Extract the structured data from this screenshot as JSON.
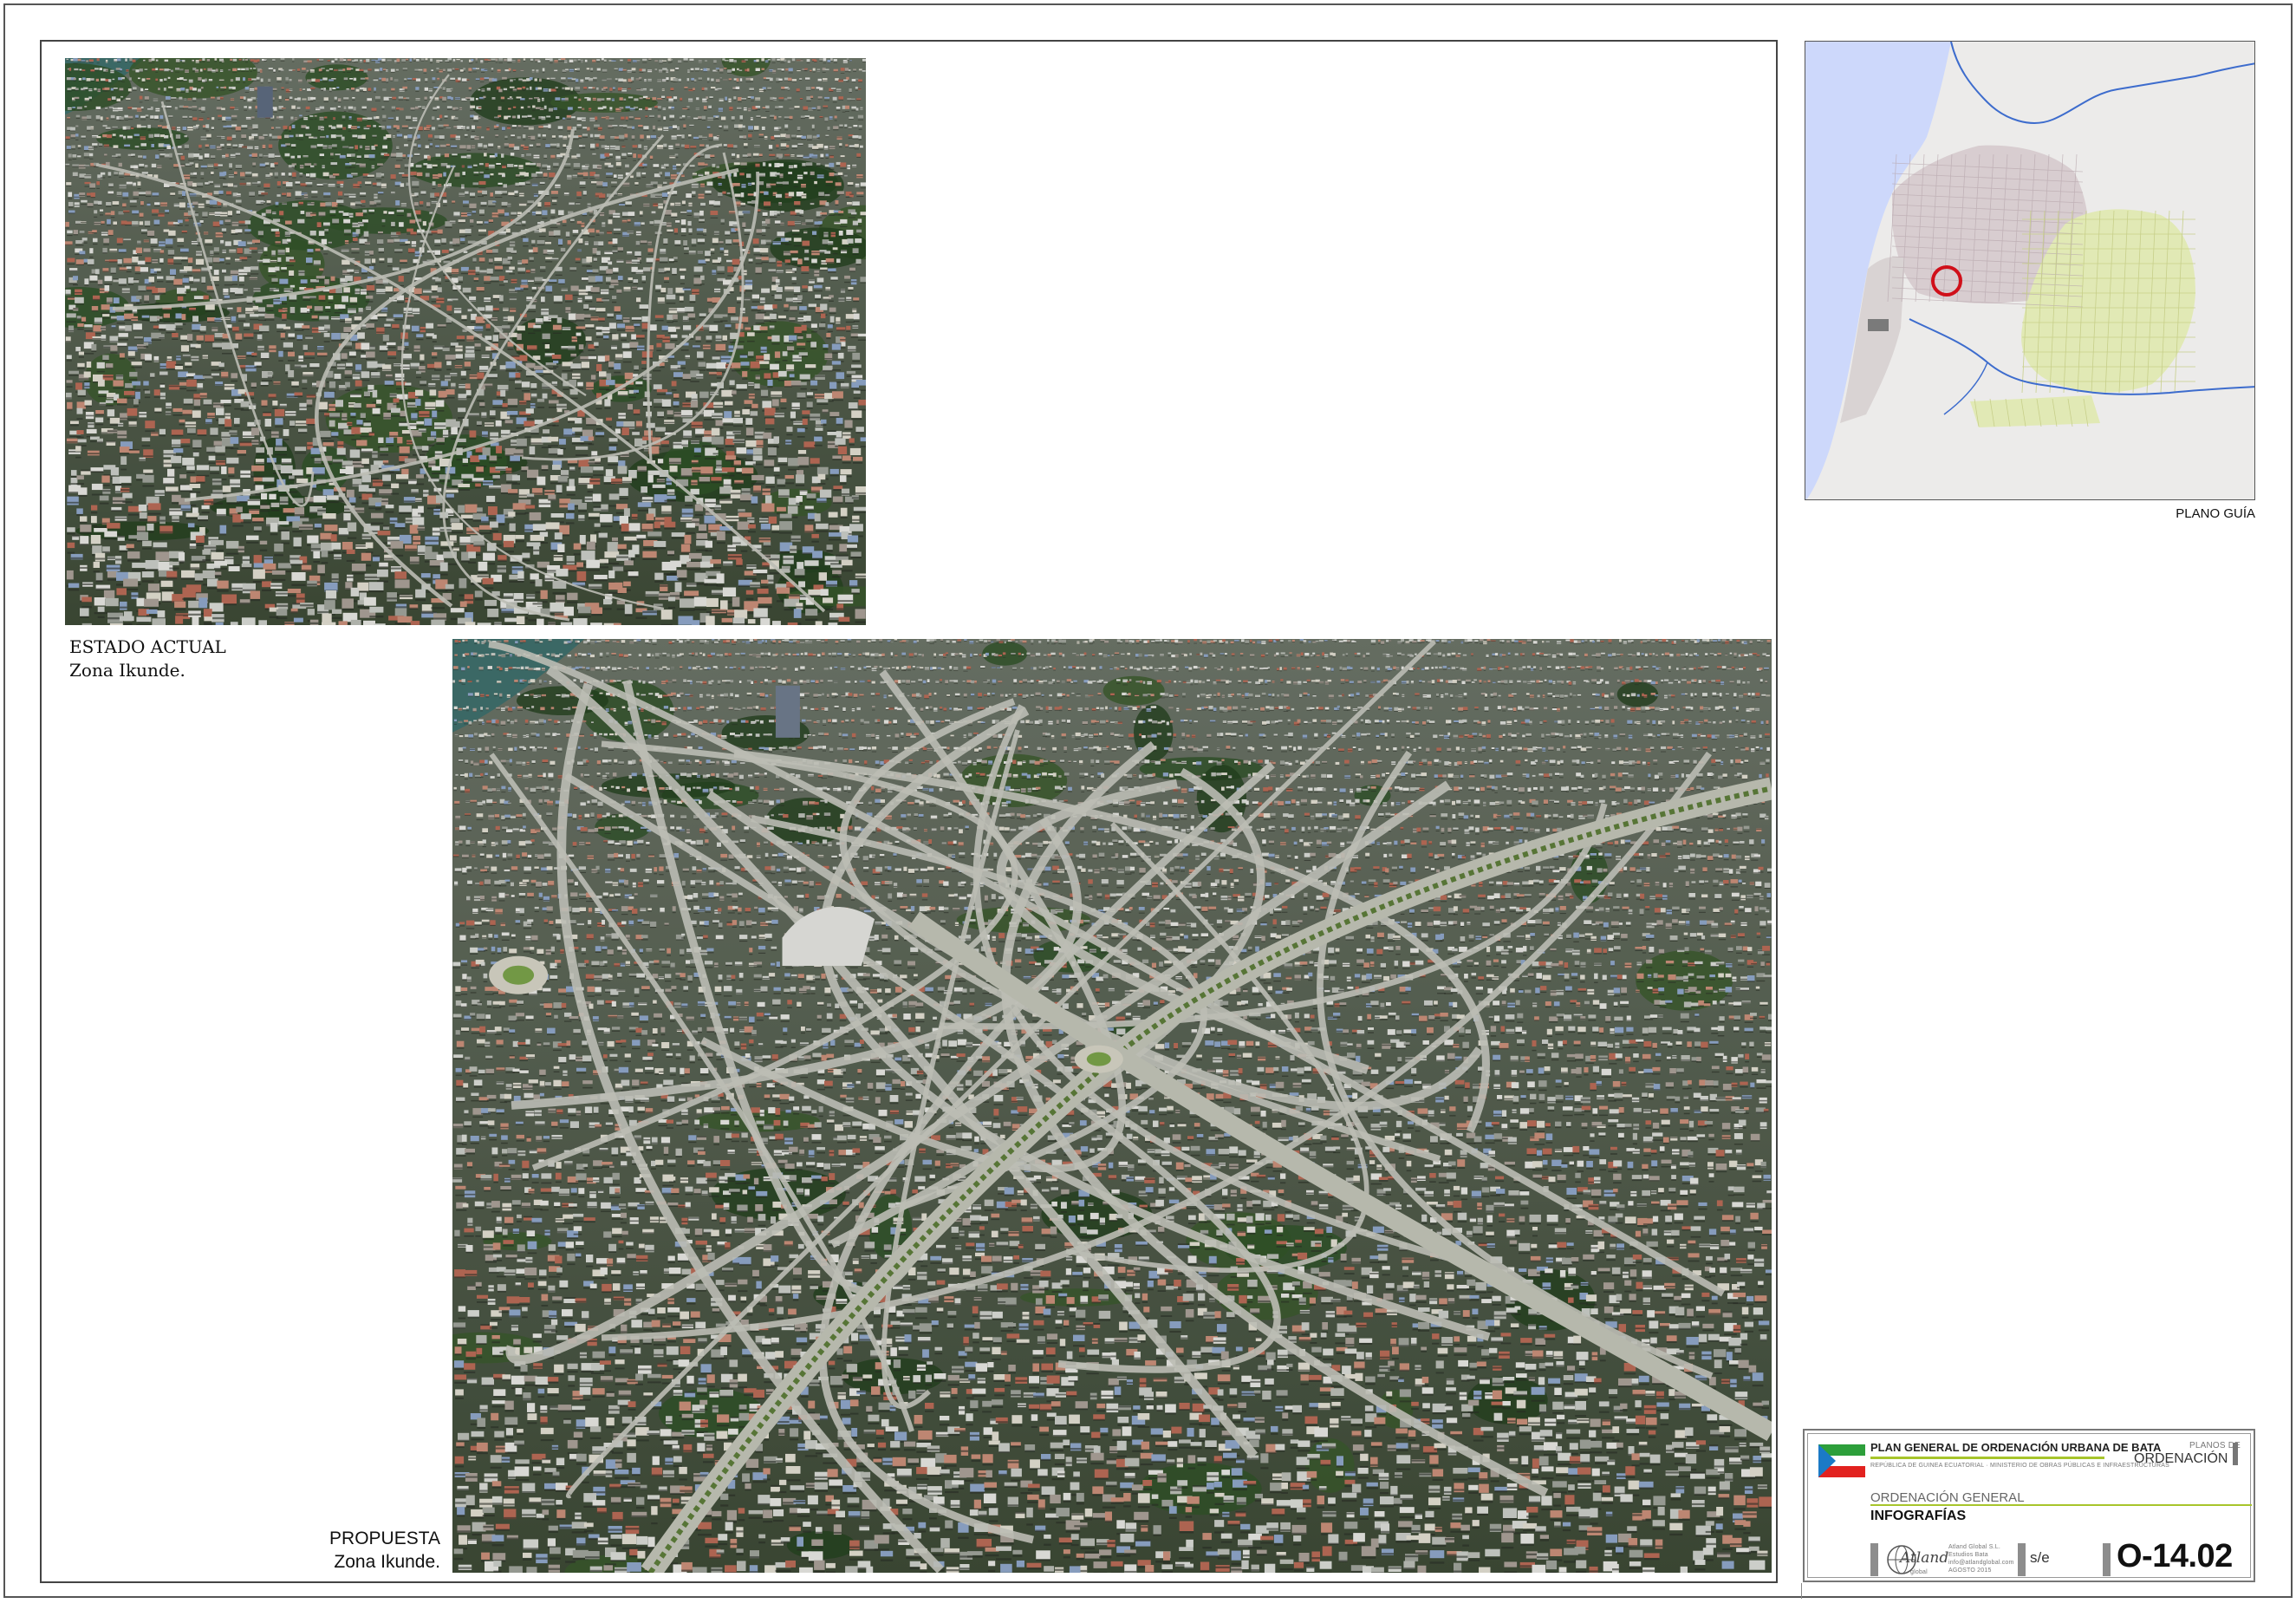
{
  "photos": {
    "current": {
      "label_status": "ESTADO ACTUAL",
      "label_zone": "Zona Ikunde."
    },
    "proposal": {
      "label_status": "PROPUESTA",
      "label_zone": "Zona Ikunde."
    }
  },
  "guide_map": {
    "label": "PLANO GUÍA",
    "colors": {
      "sea": "#cdd8fb",
      "land": "#ecebea",
      "urban": "#d8cdd0",
      "expansion": "#e1e9b5",
      "river": "#3d6ccd",
      "marker": "#d0101a"
    }
  },
  "title_block": {
    "project": "PLAN GENERAL DE ORDENACIÓN URBANA DE BATA",
    "authority": "REPÚBLICA DE GUINEA ECUATORIAL · MINISTERIO DE OBRAS PÚBLICAS E INFRAESTRUCTURAS",
    "series_small": "PLANOS DE",
    "series": "ORDENACIÓN",
    "section": "ORDENACIÓN GENERAL",
    "sheet_title": "INFOGRAFÍAS",
    "firm_logo": "Atland",
    "firm_logo_sub": "global",
    "firm_lines": [
      "Atland Global S.L.",
      "Estudios Bata",
      "info@atlandglobal.com",
      "AGOSTO 2015"
    ],
    "scale": "s/e",
    "sheet_number": "O-14.02",
    "flag_colors": {
      "blue": "#1b7ac6",
      "green": "#2d9f3b",
      "white": "#ffffff",
      "red": "#e2221f"
    },
    "accent": "#a7c52b"
  }
}
